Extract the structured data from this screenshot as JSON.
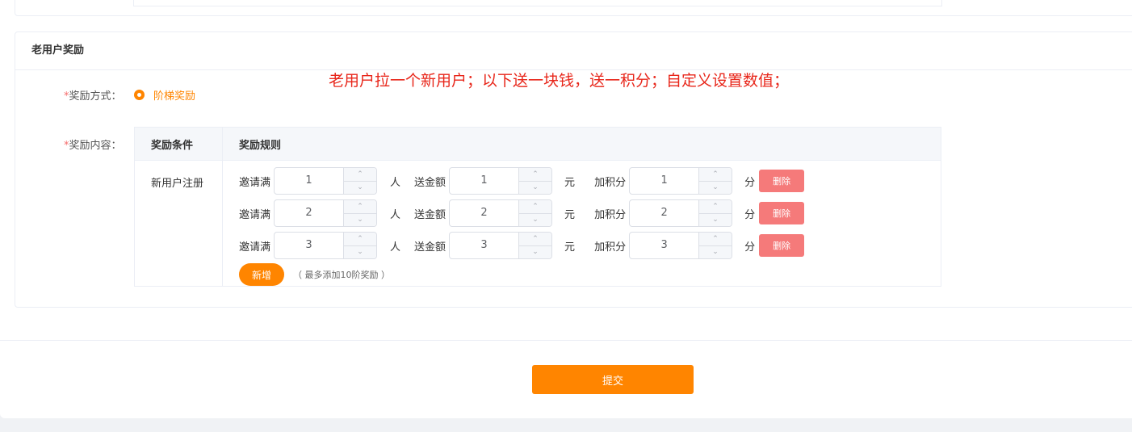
{
  "section": {
    "title": "老用户奖励"
  },
  "note": "老用户拉一个新用户；以下送一块钱，送一积分；自定义设置数值；",
  "form": {
    "required_mark": "*",
    "method_label": "奖励方式：",
    "method_option": "阶梯奖励",
    "content_label": "奖励内容："
  },
  "table": {
    "headers": [
      "奖励条件",
      "奖励规则"
    ],
    "condition": "新用户注册",
    "invite_label": "邀请满",
    "invite_unit": "人",
    "money_label": "送金额",
    "money_unit": "元",
    "points_label": "加积分",
    "points_unit": "分",
    "delete_label": "删除",
    "rows": [
      {
        "invite": "1",
        "money": "1",
        "points": "1"
      },
      {
        "invite": "2",
        "money": "2",
        "points": "2"
      },
      {
        "invite": "3",
        "money": "3",
        "points": "3"
      }
    ],
    "add_label": "新增",
    "add_hint": "（ 最多添加10阶奖励 ）"
  },
  "submit_label": "提交",
  "icons": {
    "up": "chevron-up-icon",
    "down": "chevron-down-icon"
  },
  "colors": {
    "accent": "#ff8500",
    "danger": "#f56c6c",
    "note": "#e8261a"
  }
}
